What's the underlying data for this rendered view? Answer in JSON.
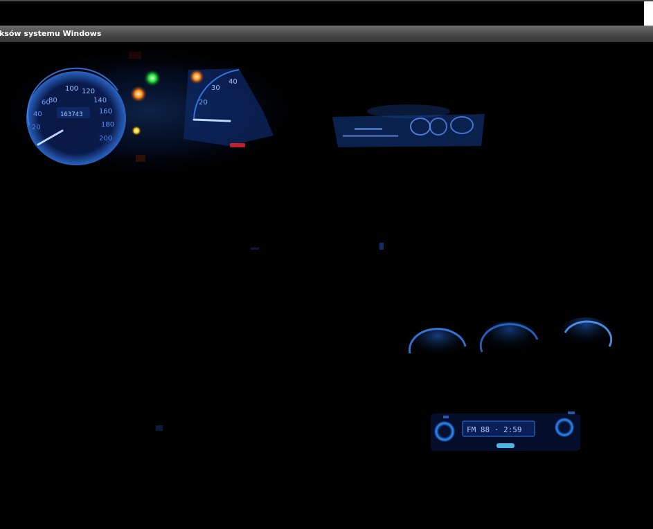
{
  "window": {
    "title": "ksów systemu Windows"
  },
  "image": {
    "subject": "car-dashboard-at-night-blue-backlight",
    "speedometer_ticks": [
      "60",
      "80",
      "100",
      "120",
      "140",
      "160",
      "180",
      "200",
      "40",
      "20"
    ],
    "tachometer_ticks": [
      "20",
      "30",
      "40"
    ],
    "odometer": "163743",
    "warning_lights": [
      {
        "name": "green-indicator",
        "color": "#22e03a"
      },
      {
        "name": "orange-indicator-left",
        "color": "#ff8a1a"
      },
      {
        "name": "orange-indicator-right",
        "color": "#ff9a1a"
      },
      {
        "name": "yellow-indicator",
        "color": "#ffd21a"
      },
      {
        "name": "red-indicator",
        "color": "#ff2a3a"
      }
    ],
    "radio_display": "FM 88  ·  2:59",
    "backlight_color": "#2a7cff"
  }
}
